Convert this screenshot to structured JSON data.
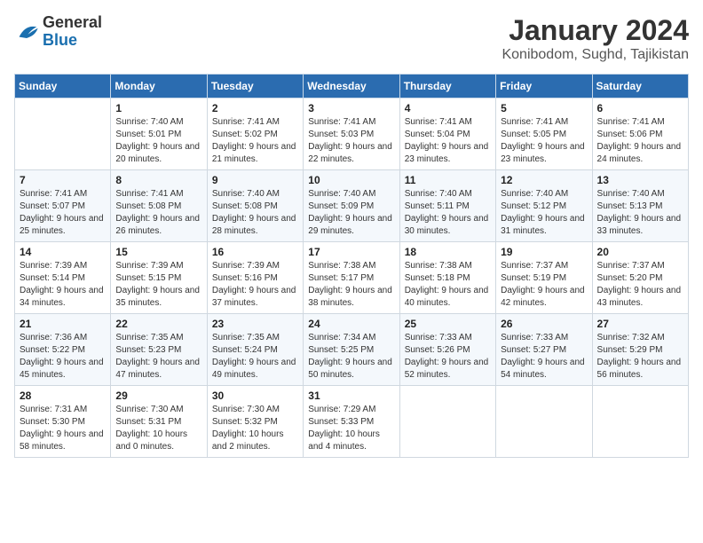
{
  "logo": {
    "general": "General",
    "blue": "Blue"
  },
  "header": {
    "month_year": "January 2024",
    "location": "Konibodom, Sughd, Tajikistan"
  },
  "days_of_week": [
    "Sunday",
    "Monday",
    "Tuesday",
    "Wednesday",
    "Thursday",
    "Friday",
    "Saturday"
  ],
  "weeks": [
    [
      {
        "day": "",
        "sunrise": "",
        "sunset": "",
        "daylight": ""
      },
      {
        "day": "1",
        "sunrise": "Sunrise: 7:40 AM",
        "sunset": "Sunset: 5:01 PM",
        "daylight": "Daylight: 9 hours and 20 minutes."
      },
      {
        "day": "2",
        "sunrise": "Sunrise: 7:41 AM",
        "sunset": "Sunset: 5:02 PM",
        "daylight": "Daylight: 9 hours and 21 minutes."
      },
      {
        "day": "3",
        "sunrise": "Sunrise: 7:41 AM",
        "sunset": "Sunset: 5:03 PM",
        "daylight": "Daylight: 9 hours and 22 minutes."
      },
      {
        "day": "4",
        "sunrise": "Sunrise: 7:41 AM",
        "sunset": "Sunset: 5:04 PM",
        "daylight": "Daylight: 9 hours and 23 minutes."
      },
      {
        "day": "5",
        "sunrise": "Sunrise: 7:41 AM",
        "sunset": "Sunset: 5:05 PM",
        "daylight": "Daylight: 9 hours and 23 minutes."
      },
      {
        "day": "6",
        "sunrise": "Sunrise: 7:41 AM",
        "sunset": "Sunset: 5:06 PM",
        "daylight": "Daylight: 9 hours and 24 minutes."
      }
    ],
    [
      {
        "day": "7",
        "sunrise": "Sunrise: 7:41 AM",
        "sunset": "Sunset: 5:07 PM",
        "daylight": "Daylight: 9 hours and 25 minutes."
      },
      {
        "day": "8",
        "sunrise": "Sunrise: 7:41 AM",
        "sunset": "Sunset: 5:08 PM",
        "daylight": "Daylight: 9 hours and 26 minutes."
      },
      {
        "day": "9",
        "sunrise": "Sunrise: 7:40 AM",
        "sunset": "Sunset: 5:08 PM",
        "daylight": "Daylight: 9 hours and 28 minutes."
      },
      {
        "day": "10",
        "sunrise": "Sunrise: 7:40 AM",
        "sunset": "Sunset: 5:09 PM",
        "daylight": "Daylight: 9 hours and 29 minutes."
      },
      {
        "day": "11",
        "sunrise": "Sunrise: 7:40 AM",
        "sunset": "Sunset: 5:11 PM",
        "daylight": "Daylight: 9 hours and 30 minutes."
      },
      {
        "day": "12",
        "sunrise": "Sunrise: 7:40 AM",
        "sunset": "Sunset: 5:12 PM",
        "daylight": "Daylight: 9 hours and 31 minutes."
      },
      {
        "day": "13",
        "sunrise": "Sunrise: 7:40 AM",
        "sunset": "Sunset: 5:13 PM",
        "daylight": "Daylight: 9 hours and 33 minutes."
      }
    ],
    [
      {
        "day": "14",
        "sunrise": "Sunrise: 7:39 AM",
        "sunset": "Sunset: 5:14 PM",
        "daylight": "Daylight: 9 hours and 34 minutes."
      },
      {
        "day": "15",
        "sunrise": "Sunrise: 7:39 AM",
        "sunset": "Sunset: 5:15 PM",
        "daylight": "Daylight: 9 hours and 35 minutes."
      },
      {
        "day": "16",
        "sunrise": "Sunrise: 7:39 AM",
        "sunset": "Sunset: 5:16 PM",
        "daylight": "Daylight: 9 hours and 37 minutes."
      },
      {
        "day": "17",
        "sunrise": "Sunrise: 7:38 AM",
        "sunset": "Sunset: 5:17 PM",
        "daylight": "Daylight: 9 hours and 38 minutes."
      },
      {
        "day": "18",
        "sunrise": "Sunrise: 7:38 AM",
        "sunset": "Sunset: 5:18 PM",
        "daylight": "Daylight: 9 hours and 40 minutes."
      },
      {
        "day": "19",
        "sunrise": "Sunrise: 7:37 AM",
        "sunset": "Sunset: 5:19 PM",
        "daylight": "Daylight: 9 hours and 42 minutes."
      },
      {
        "day": "20",
        "sunrise": "Sunrise: 7:37 AM",
        "sunset": "Sunset: 5:20 PM",
        "daylight": "Daylight: 9 hours and 43 minutes."
      }
    ],
    [
      {
        "day": "21",
        "sunrise": "Sunrise: 7:36 AM",
        "sunset": "Sunset: 5:22 PM",
        "daylight": "Daylight: 9 hours and 45 minutes."
      },
      {
        "day": "22",
        "sunrise": "Sunrise: 7:35 AM",
        "sunset": "Sunset: 5:23 PM",
        "daylight": "Daylight: 9 hours and 47 minutes."
      },
      {
        "day": "23",
        "sunrise": "Sunrise: 7:35 AM",
        "sunset": "Sunset: 5:24 PM",
        "daylight": "Daylight: 9 hours and 49 minutes."
      },
      {
        "day": "24",
        "sunrise": "Sunrise: 7:34 AM",
        "sunset": "Sunset: 5:25 PM",
        "daylight": "Daylight: 9 hours and 50 minutes."
      },
      {
        "day": "25",
        "sunrise": "Sunrise: 7:33 AM",
        "sunset": "Sunset: 5:26 PM",
        "daylight": "Daylight: 9 hours and 52 minutes."
      },
      {
        "day": "26",
        "sunrise": "Sunrise: 7:33 AM",
        "sunset": "Sunset: 5:27 PM",
        "daylight": "Daylight: 9 hours and 54 minutes."
      },
      {
        "day": "27",
        "sunrise": "Sunrise: 7:32 AM",
        "sunset": "Sunset: 5:29 PM",
        "daylight": "Daylight: 9 hours and 56 minutes."
      }
    ],
    [
      {
        "day": "28",
        "sunrise": "Sunrise: 7:31 AM",
        "sunset": "Sunset: 5:30 PM",
        "daylight": "Daylight: 9 hours and 58 minutes."
      },
      {
        "day": "29",
        "sunrise": "Sunrise: 7:30 AM",
        "sunset": "Sunset: 5:31 PM",
        "daylight": "Daylight: 10 hours and 0 minutes."
      },
      {
        "day": "30",
        "sunrise": "Sunrise: 7:30 AM",
        "sunset": "Sunset: 5:32 PM",
        "daylight": "Daylight: 10 hours and 2 minutes."
      },
      {
        "day": "31",
        "sunrise": "Sunrise: 7:29 AM",
        "sunset": "Sunset: 5:33 PM",
        "daylight": "Daylight: 10 hours and 4 minutes."
      },
      {
        "day": "",
        "sunrise": "",
        "sunset": "",
        "daylight": ""
      },
      {
        "day": "",
        "sunrise": "",
        "sunset": "",
        "daylight": ""
      },
      {
        "day": "",
        "sunrise": "",
        "sunset": "",
        "daylight": ""
      }
    ]
  ]
}
